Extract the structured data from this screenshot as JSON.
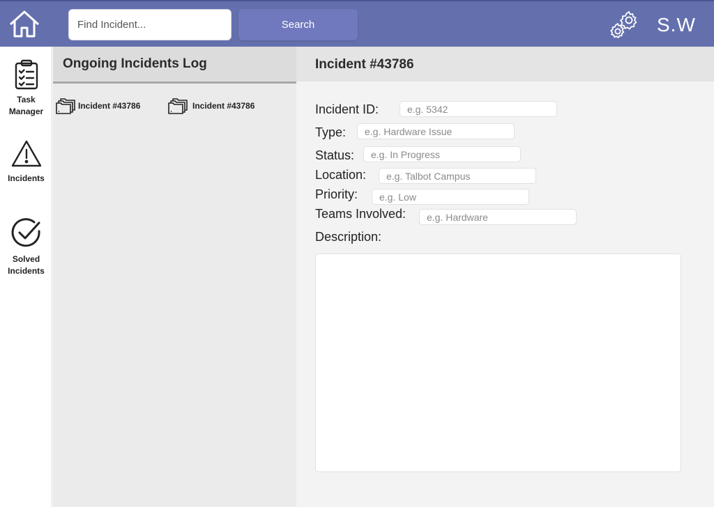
{
  "topbar": {
    "home_icon": "home-icon",
    "search": {
      "placeholder": "Find Incident...",
      "value": ""
    },
    "search_button_label": "Search",
    "settings_icon": "gear-icon",
    "user_initials": "S.W",
    "colors": {
      "bar": "#6470ad",
      "button": "#7079bd"
    }
  },
  "sidebar": {
    "items": [
      {
        "icon": "clipboard-checklist-icon",
        "label_line1": "Task",
        "label_line2": "Manager"
      },
      {
        "icon": "warning-triangle-icon",
        "label_line1": "Incidents"
      },
      {
        "icon": "check-circle-icon",
        "label_line1": "Solved",
        "label_line2": "Incidents"
      }
    ]
  },
  "log": {
    "title": "Ongoing Incidents Log",
    "items": [
      {
        "icon": "folders-icon",
        "label": "Incident #43786"
      },
      {
        "icon": "folders-icon",
        "label": "Incident #43786"
      }
    ]
  },
  "detail": {
    "title": "Incident #43786",
    "fields": {
      "incident_id": {
        "label": "Incident ID:",
        "placeholder": "e.g. 5342",
        "value": ""
      },
      "type": {
        "label": "Type:",
        "placeholder": "e.g. Hardware Issue",
        "value": ""
      },
      "status": {
        "label": "Status:",
        "placeholder": "e.g. In Progress",
        "value": ""
      },
      "location": {
        "label": "Location:",
        "placeholder": "e.g. Talbot Campus",
        "value": ""
      },
      "priority": {
        "label": "Priority:",
        "placeholder": "e.g. Low",
        "value": ""
      },
      "teams": {
        "label": "Teams Involved:",
        "placeholder": "e.g. Hardware",
        "value": ""
      }
    },
    "description_label": "Description:",
    "description_value": ""
  }
}
